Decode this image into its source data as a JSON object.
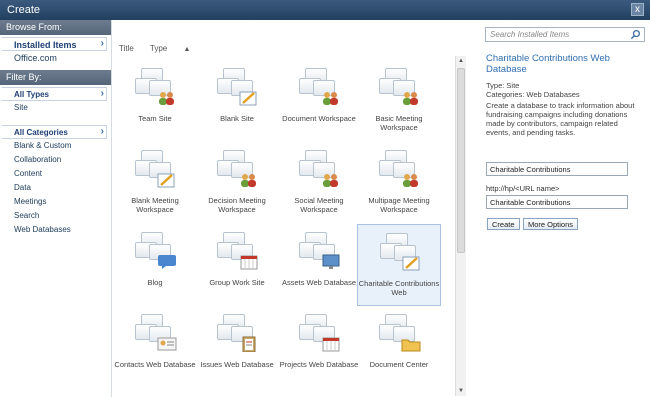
{
  "dialog": {
    "title": "Create",
    "close_symbol": "x"
  },
  "sidebar": {
    "browse_header": "Browse From:",
    "browse_items": [
      {
        "label": "Installed Items",
        "selected": true
      },
      {
        "label": "Office.com",
        "selected": false
      }
    ],
    "filter_header": "Filter By:",
    "types": [
      {
        "label": "All Types",
        "selected": true
      },
      {
        "label": "Site",
        "selected": false
      }
    ],
    "categories": [
      {
        "label": "All Categories",
        "selected": true
      },
      {
        "label": "Blank & Custom",
        "selected": false
      },
      {
        "label": "Collaboration",
        "selected": false
      },
      {
        "label": "Content",
        "selected": false
      },
      {
        "label": "Data",
        "selected": false
      },
      {
        "label": "Meetings",
        "selected": false
      },
      {
        "label": "Search",
        "selected": false
      },
      {
        "label": "Web Databases",
        "selected": false
      }
    ]
  },
  "main": {
    "sort_title": "Title",
    "sort_type": "Type",
    "sort_arrow": "▲",
    "tiles": [
      {
        "label": "Team Site",
        "badge": "people"
      },
      {
        "label": "Blank Site",
        "badge": "pencil"
      },
      {
        "label": "Document Workspace",
        "badge": "people"
      },
      {
        "label": "Basic Meeting Workspace",
        "badge": "people"
      },
      {
        "label": "Blank Meeting Workspace",
        "badge": "pencil"
      },
      {
        "label": "Decision Meeting Workspace",
        "badge": "people"
      },
      {
        "label": "Social Meeting Workspace",
        "badge": "people"
      },
      {
        "label": "Multipage Meeting Workspace",
        "badge": "people"
      },
      {
        "label": "Blog",
        "badge": "chat"
      },
      {
        "label": "Group Work Site",
        "badge": "calendar"
      },
      {
        "label": "Assets Web Database",
        "badge": "monitor"
      },
      {
        "label": "Charitable Contributions Web",
        "badge": "pencil",
        "selected": true
      },
      {
        "label": "Contacts Web Database",
        "badge": "card"
      },
      {
        "label": "Issues Web Database",
        "badge": "clipboard"
      },
      {
        "label": "Projects Web Database",
        "badge": "calendar"
      },
      {
        "label": "Document Center",
        "badge": "folder"
      }
    ]
  },
  "details": {
    "search_placeholder": "Search Installed Items",
    "title": "Charitable Contributions Web Database",
    "type_line": "Type: Site",
    "categories_line": "Categories: Web Databases",
    "description": "Create a database to track information about fundraising campaigns including donations made by contributors, campaign related events, and pending tasks.",
    "name_value": "Charitable Contributions",
    "url_label": "http://hp/<URL name>",
    "url_value": "Charitable Contributions",
    "create_button": "Create",
    "more_options_button": "More Options"
  },
  "colors": {
    "title_bar": "#2c4b6e",
    "section_header": "#626f80",
    "link": "#2f6fb1",
    "selected_tile": "#e8f1fa"
  }
}
